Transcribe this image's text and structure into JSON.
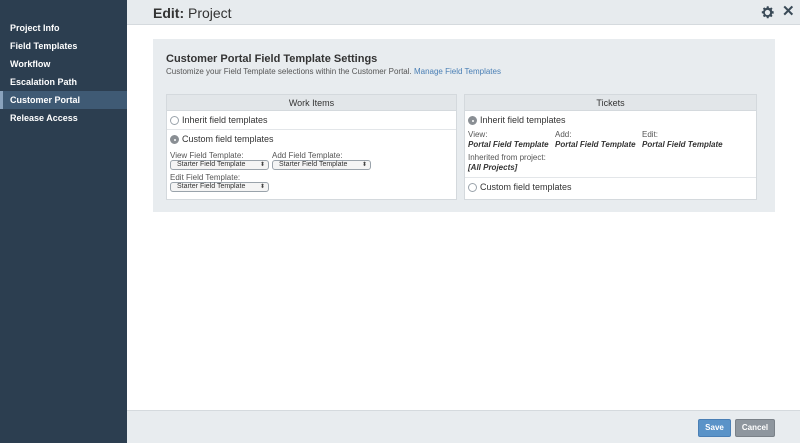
{
  "sidebar": {
    "items": [
      {
        "label": "Project Info"
      },
      {
        "label": "Field Templates"
      },
      {
        "label": "Workflow"
      },
      {
        "label": "Escalation Path"
      },
      {
        "label": "Customer Portal",
        "active": true
      },
      {
        "label": "Release Access"
      }
    ]
  },
  "header": {
    "title_prefix": "Edit:",
    "title_name": "Project",
    "icons": [
      "gear-icon",
      "close-icon"
    ]
  },
  "panel": {
    "title": "Customer Portal Field Template Settings",
    "description": "Customize your Field Template selections within the Customer Portal.",
    "manage_link": "Manage Field Templates"
  },
  "work_items": {
    "heading": "Work Items",
    "inherit_label": "Inherit field templates",
    "custom_label": "Custom field templates",
    "selected": "custom",
    "view_label": "View Field Template:",
    "view_value": "Starter Field Template",
    "add_label": "Add Field Template:",
    "add_value": "Starter Field Template",
    "edit_label": "Edit Field Template:",
    "edit_value": "Starter Field Template"
  },
  "tickets": {
    "heading": "Tickets",
    "inherit_label": "Inherit field templates",
    "custom_label": "Custom field templates",
    "selected": "inherit",
    "view_label": "View:",
    "view_value": "Portal Field Template",
    "add_label": "Add:",
    "add_value": "Portal Field Template",
    "edit_label": "Edit:",
    "edit_value": "Portal Field Template",
    "inherited_label": "Inherited from project:",
    "inherited_value": "[All Projects]"
  },
  "footer": {
    "save_label": "Save",
    "cancel_label": "Cancel"
  },
  "colors": {
    "sidebar_bg": "#2c3e50",
    "accent_link": "#4a7fb5",
    "save_button": "#5a93c8",
    "cancel_button": "#8e969e"
  }
}
